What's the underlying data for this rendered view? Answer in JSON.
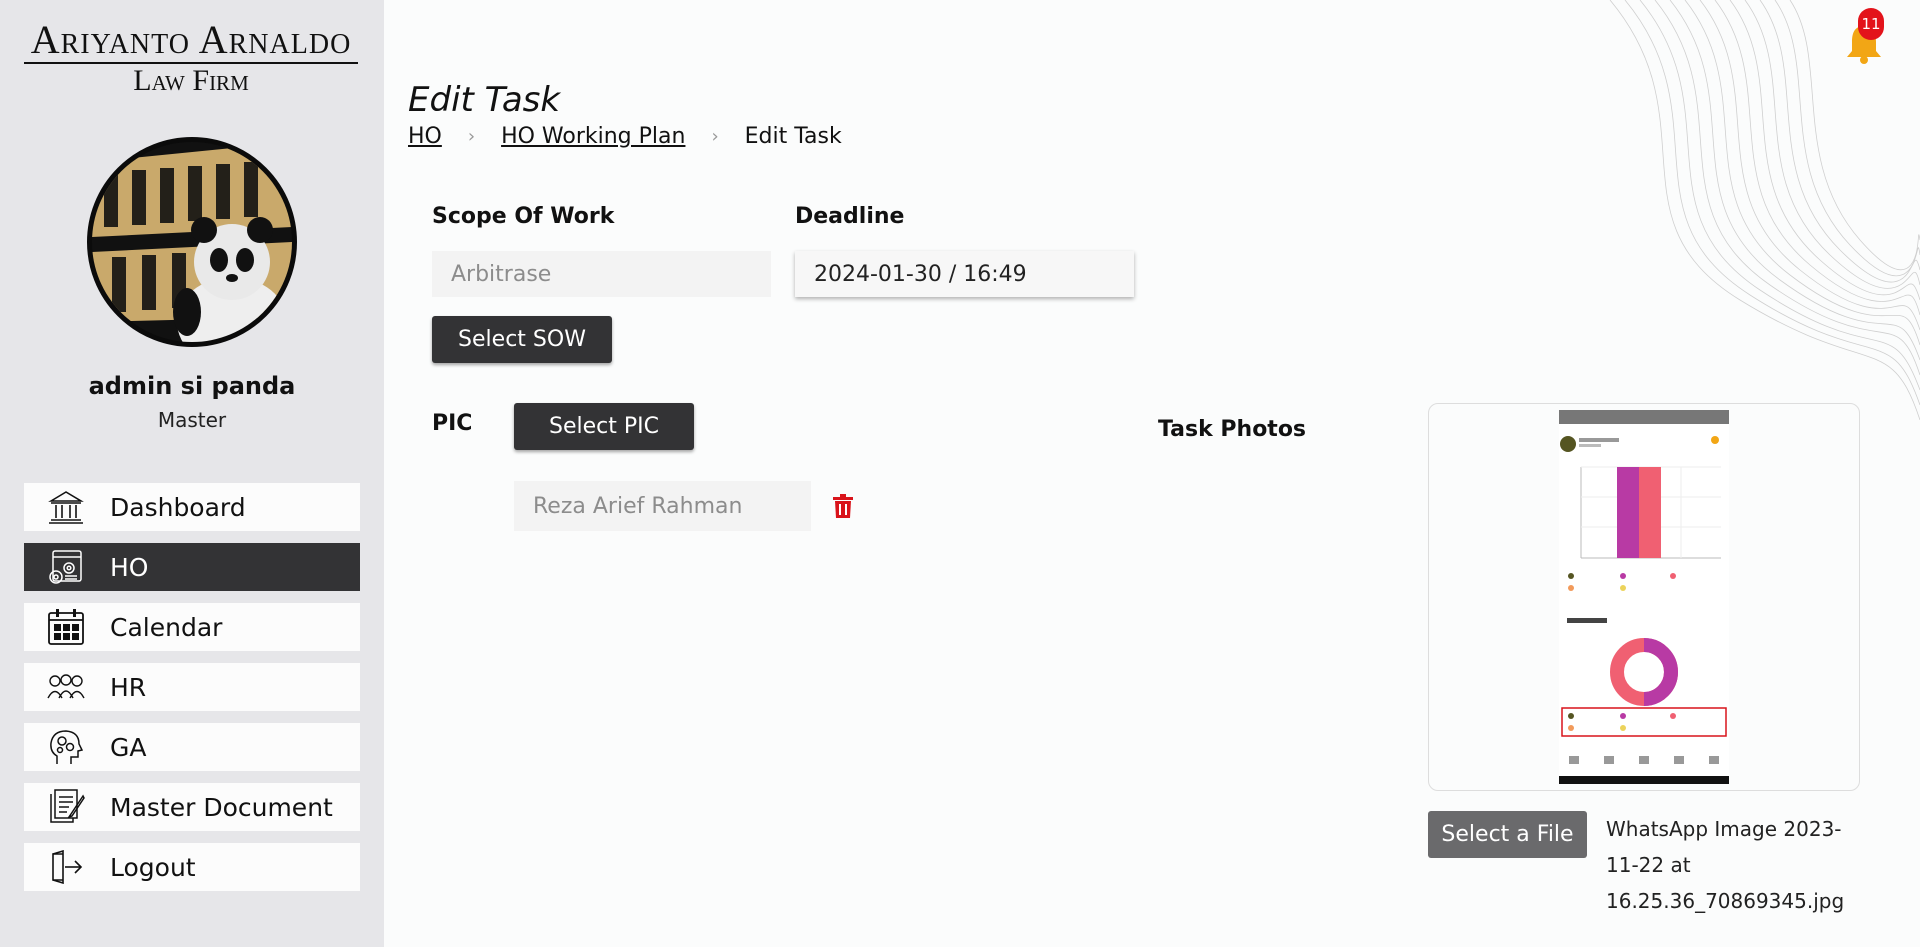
{
  "sidebar": {
    "logo_line1": "Ariyanto Arnaldo",
    "logo_line2": "Law Firm",
    "user_name": "admin si panda",
    "user_role": "Master",
    "items": [
      {
        "label": "Dashboard",
        "icon": "bank-icon"
      },
      {
        "label": "HO",
        "icon": "office-settings-icon",
        "active": true
      },
      {
        "label": "Calendar",
        "icon": "calendar-icon"
      },
      {
        "label": "HR",
        "icon": "people-icon"
      },
      {
        "label": "GA",
        "icon": "head-gears-icon"
      },
      {
        "label": "Master Document",
        "icon": "document-icon"
      },
      {
        "label": "Logout",
        "icon": "logout-icon"
      }
    ]
  },
  "header": {
    "notification_count": "11"
  },
  "page": {
    "title": "Edit Task",
    "breadcrumb": [
      "HO",
      "HO Working Plan",
      "Edit Task"
    ]
  },
  "form": {
    "scope_label": "Scope Of Work",
    "scope_placeholder": "Arbitrase",
    "deadline_label": "Deadline",
    "deadline_value": "2024-01-30 / 16:49",
    "select_sow_label": "Select SOW",
    "pic_label": "PIC",
    "select_pic_label": "Select PIC",
    "pic_value": "Reza Arief Rahman",
    "task_photos_label": "Task Photos",
    "select_file_label": "Select a File",
    "file_name": "WhatsApp Image 2023-11-22 at 16.25.36_70869345.jpg"
  },
  "colors": {
    "accent_dark": "#333335",
    "badge": "#e3131b",
    "trash": "#d9141b"
  }
}
